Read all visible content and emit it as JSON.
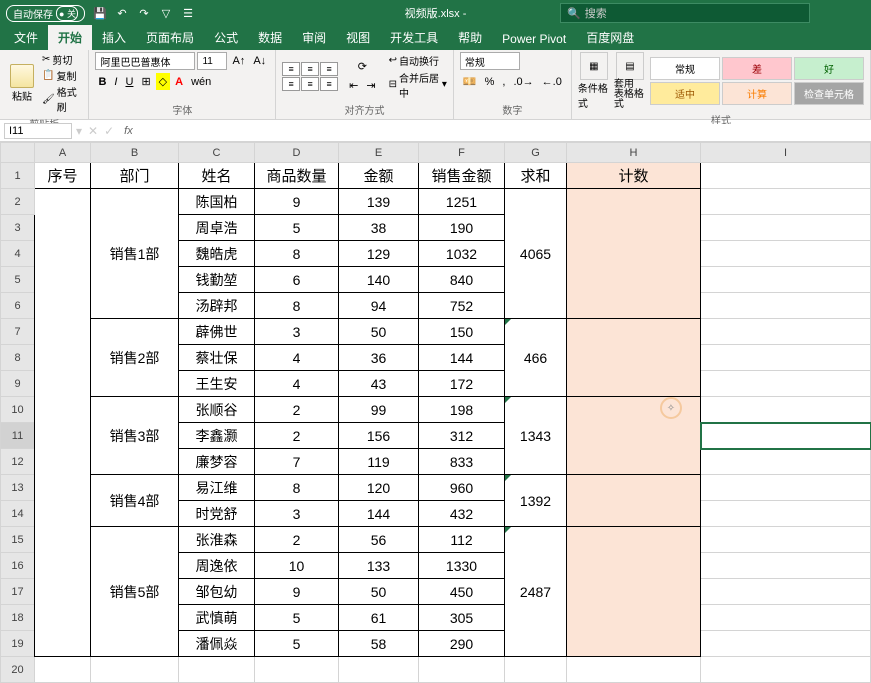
{
  "titlebar": {
    "auto_save": "自动保存",
    "auto_save_state": "关",
    "filename": "视频版.xlsx  -",
    "search_placeholder": "搜索"
  },
  "tabs": [
    "文件",
    "开始",
    "插入",
    "页面布局",
    "公式",
    "数据",
    "审阅",
    "视图",
    "开发工具",
    "帮助",
    "Power Pivot",
    "百度网盘"
  ],
  "active_tab": 1,
  "ribbon": {
    "paste": "粘贴",
    "cut": "剪切",
    "copy": "复制",
    "format_painter": "格式刷",
    "clipboard_label": "剪贴板",
    "font_name": "阿里巴巴普惠体",
    "font_size": "11",
    "font_label": "字体",
    "align_label": "对齐方式",
    "wrap": "自动换行",
    "merge": "合并后居中",
    "number_format": "常规",
    "number_label": "数字",
    "cond_fmt": "条件格式",
    "table_fmt": "套用\n表格格式",
    "styles_label": "样式",
    "style_normal": "常规",
    "style_bad": "差",
    "style_good": "好",
    "style_neutral": "适中",
    "style_calc": "计算",
    "style_check": "检查单元格"
  },
  "name_box": "I11",
  "columns": [
    "A",
    "B",
    "C",
    "D",
    "E",
    "F",
    "G",
    "H",
    "I"
  ],
  "headers": {
    "A": "序号",
    "B": "部门",
    "C": "姓名",
    "D": "商品数量",
    "E": "金额",
    "F": "销售金额",
    "G": "求和",
    "H": "计数"
  },
  "chart_data": {
    "type": "table",
    "groups": [
      {
        "dept": "销售1部",
        "span": 5,
        "sum": 4065,
        "rows": [
          {
            "name": "陈国柏",
            "qty": 9,
            "amt": 139,
            "sales": 1251
          },
          {
            "name": "周卓浩",
            "qty": 5,
            "amt": 38,
            "sales": 190
          },
          {
            "name": "魏皓虎",
            "qty": 8,
            "amt": 129,
            "sales": 1032
          },
          {
            "name": "钱勤堃",
            "qty": 6,
            "amt": 140,
            "sales": 840
          },
          {
            "name": "汤辟邦",
            "qty": 8,
            "amt": 94,
            "sales": 752
          }
        ]
      },
      {
        "dept": "销售2部",
        "span": 3,
        "sum": 466,
        "rows": [
          {
            "name": "薜佛世",
            "qty": 3,
            "amt": 50,
            "sales": 150
          },
          {
            "name": "蔡壮保",
            "qty": 4,
            "amt": 36,
            "sales": 144
          },
          {
            "name": "王生安",
            "qty": 4,
            "amt": 43,
            "sales": 172
          }
        ]
      },
      {
        "dept": "销售3部",
        "span": 3,
        "sum": 1343,
        "rows": [
          {
            "name": "张顺谷",
            "qty": 2,
            "amt": 99,
            "sales": 198
          },
          {
            "name": "李鑫灏",
            "qty": 2,
            "amt": 156,
            "sales": 312
          },
          {
            "name": "廉梦容",
            "qty": 7,
            "amt": 119,
            "sales": 833
          }
        ]
      },
      {
        "dept": "销售4部",
        "span": 2,
        "sum": 1392,
        "rows": [
          {
            "name": "易江维",
            "qty": 8,
            "amt": 120,
            "sales": 960
          },
          {
            "name": "时党舒",
            "qty": 3,
            "amt": 144,
            "sales": 432
          }
        ]
      },
      {
        "dept": "销售5部",
        "span": 5,
        "sum": 2487,
        "rows": [
          {
            "name": "张淮森",
            "qty": 2,
            "amt": 56,
            "sales": 112
          },
          {
            "name": "周逸依",
            "qty": 10,
            "amt": 133,
            "sales": 1330
          },
          {
            "name": "邹包幼",
            "qty": 9,
            "amt": 50,
            "sales": 450
          },
          {
            "name": "武慎萌",
            "qty": 5,
            "amt": 61,
            "sales": 305
          },
          {
            "name": "潘佩焱",
            "qty": 5,
            "amt": 58,
            "sales": 290
          }
        ]
      }
    ]
  }
}
